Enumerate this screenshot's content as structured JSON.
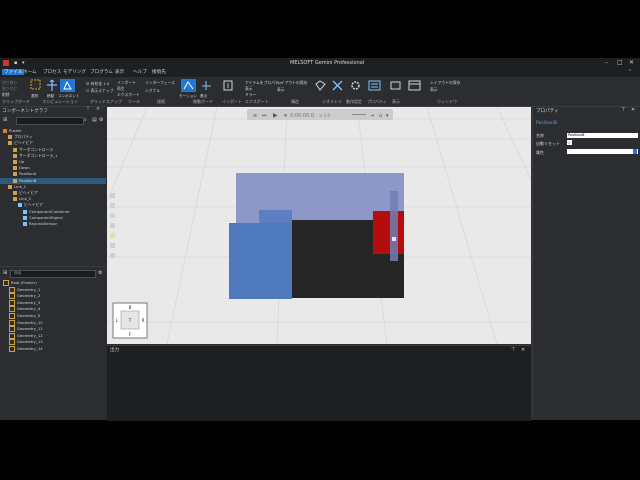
{
  "window": {
    "title": "MELSOFT Gemini Professional",
    "minimize": "–",
    "maximize": "□",
    "close": "✕"
  },
  "menu": [
    {
      "label": "ファイル",
      "active": true
    },
    {
      "label": "ホーム",
      "active": false
    },
    {
      "label": "プロセス",
      "active": false
    },
    {
      "label": "モデリング",
      "active": false
    },
    {
      "label": "プログラム",
      "active": false
    },
    {
      "label": "表示",
      "active": false
    },
    {
      "label": "ヘルプ",
      "active": false
    },
    {
      "label": "接続先",
      "active": false
    }
  ],
  "ribbon": {
    "groups": [
      "クリップボード",
      "マニピュレーション",
      "グリッドスナップ",
      "ツール",
      "接続",
      "移動ポード",
      "インポート",
      "エクスポート",
      "構造",
      "ジオメトリ",
      "動作設定",
      "プロパティ",
      "表示",
      "ウィンドウ"
    ],
    "buttons": [
      "選択",
      "移動",
      "回転",
      "コンポネント",
      "有効化 1.0",
      "表示スナップ",
      "インターフェース",
      "シグナル",
      "モーション",
      "基点",
      "エクスポート",
      "コントローラ",
      "パフォーマンス",
      "コネクタ"
    ],
    "small": [
      "切り取り",
      "貼り付け",
      "削除",
      "インポート",
      "再生",
      "エクスポート",
      "アイテムをプロパティ",
      "表示",
      "ミラー",
      "レイアウトの保存",
      "表示"
    ]
  },
  "component_graph": {
    "title": "コンポーネントグラフ",
    "search_placeholder": "",
    "rows": [
      {
        "label": "Pusher",
        "indent": 0
      },
      {
        "label": "プロパティ",
        "indent": 1
      },
      {
        "label": "ビヘイビア",
        "indent": 1
      },
      {
        "label": "サーボコントローラ",
        "indent": 2
      },
      {
        "label": "サーボコントローラ_1",
        "indent": 2
      },
      {
        "label": "Up",
        "indent": 2
      },
      {
        "label": "Down",
        "indent": 2
      },
      {
        "label": "PositionA",
        "indent": 2
      },
      {
        "label": "PositionB",
        "indent": 2,
        "selected": true
      },
      {
        "label": "Link_1",
        "indent": 1
      },
      {
        "label": "ビヘイビア",
        "indent": 2
      },
      {
        "label": "Link_2",
        "indent": 2
      },
      {
        "label": "ビヘイビア",
        "indent": 3
      },
      {
        "label": "ComponentContainer",
        "indent": 4
      },
      {
        "label": "ComponentSignal",
        "indent": 4
      },
      {
        "label": "RaycastSensor",
        "indent": 4
      }
    ]
  },
  "geometry_tree": {
    "search_placeholder": "検索",
    "rows": [
      {
        "label": "Root (Pusher)",
        "indent": 0
      },
      {
        "label": "Geometry_1",
        "indent": 1
      },
      {
        "label": "Geometry_2",
        "indent": 1
      },
      {
        "label": "Geometry_3",
        "indent": 1
      },
      {
        "label": "Geometry_4",
        "indent": 1
      },
      {
        "label": "Geometry_5",
        "indent": 1
      },
      {
        "label": "Geometry_10",
        "indent": 1
      },
      {
        "label": "Geometry_11",
        "indent": 1
      },
      {
        "label": "Geometry_12",
        "indent": 1
      },
      {
        "label": "Geometry_13",
        "indent": 1
      },
      {
        "label": "Geometry_14",
        "indent": 1
      }
    ]
  },
  "viewport": {
    "time": "0:00:00.0",
    "speed": "× 1.0",
    "cube": {
      "top": "B",
      "left": "L",
      "right": "R",
      "center": "T",
      "bottom": "F"
    }
  },
  "output": {
    "title": "出力"
  },
  "properties": {
    "title": "プロパティ",
    "subtitle": "PositionB",
    "rows": [
      {
        "label": "名称",
        "value": "PositionB"
      },
      {
        "label": "自動リセット",
        "value": "✓"
      },
      {
        "label": "属性",
        "value": ""
      }
    ]
  },
  "colors": {
    "accent": "#1f78d1",
    "selection": "#2d5b7e",
    "panel": "#2b2d30",
    "viewport": "#e9e9e9"
  }
}
